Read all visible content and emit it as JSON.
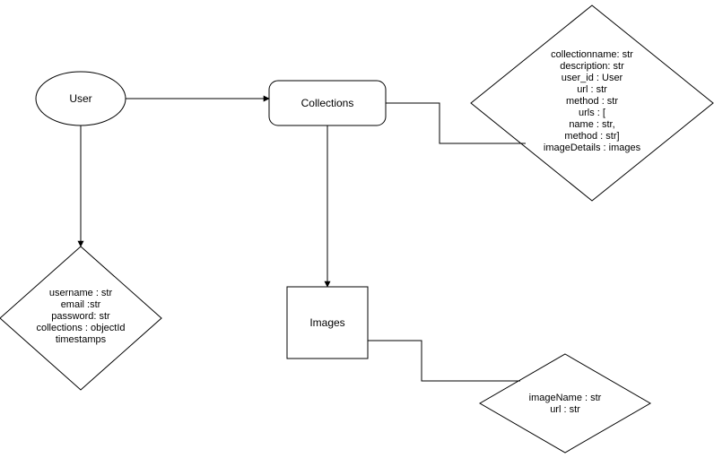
{
  "nodes": {
    "user": {
      "label": "User"
    },
    "collections": {
      "label": "Collections"
    },
    "images": {
      "label": "Images"
    },
    "userAttrs": {
      "lines": [
        "username : str",
        "email :str",
        "password: str",
        "collections : objectId",
        "timestamps"
      ]
    },
    "collectionsAttrs": {
      "lines": [
        "collectionname: str",
        "description: str",
        "user_id : User",
        "url : str",
        "method : str",
        "urls : [",
        "name : str,",
        "method : str]",
        "imageDetails : images"
      ]
    },
    "imagesAttrs": {
      "lines": [
        "imageName : str",
        "url : str"
      ]
    }
  }
}
